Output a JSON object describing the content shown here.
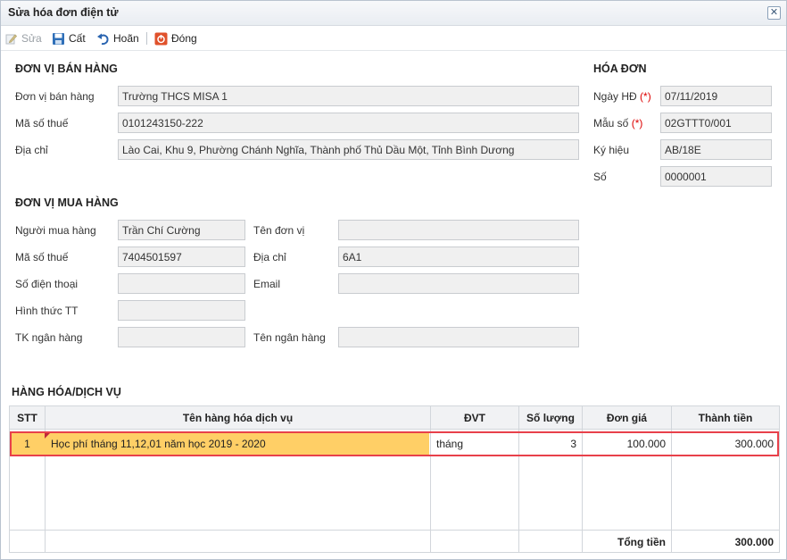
{
  "window": {
    "title": "Sửa hóa đơn điện tử",
    "close": "✕"
  },
  "toolbar": {
    "edit_label": "Sửa",
    "save_label": "Cất",
    "undo_label": "Hoãn",
    "close_label": "Đóng"
  },
  "seller": {
    "section_title": "ĐƠN VỊ BÁN HÀNG",
    "unit_label": "Đơn vị bán hàng",
    "unit_value": "Trường THCS MISA 1",
    "tax_label": "Mã số thuế",
    "tax_value": "0101243150-222",
    "address_label": "Địa chỉ",
    "address_value": "Lào Cai, Khu 9, Phường Chánh Nghĩa, Thành phố Thủ Dầu Một, Tỉnh Bình Dương"
  },
  "invoice": {
    "section_title": "HÓA ĐƠN",
    "date_label": "Ngày HĐ",
    "required_mark": "(*)",
    "date_value": "07/11/2019",
    "template_label": "Mẫu số",
    "template_value": "02GTTT0/001",
    "symbol_label": "Ký hiệu",
    "symbol_value": "AB/18E",
    "number_label": "Số",
    "number_value": "0000001"
  },
  "buyer": {
    "section_title": "ĐƠN VỊ MUA HÀNG",
    "buyer_label": "Người mua hàng",
    "buyer_value": "Trần Chí Cường",
    "unit_name_label": "Tên đơn vị",
    "unit_name_value": "",
    "tax_label": "Mã số thuế",
    "tax_value": "7404501597",
    "address_label": "Địa chỉ",
    "address_value": "6A1",
    "phone_label": "Số điện thoại",
    "phone_value": "",
    "email_label": "Email",
    "email_value": "",
    "payment_label": "Hình thức TT",
    "payment_value": "",
    "bank_account_label": "TK ngân hàng",
    "bank_account_value": "",
    "bank_name_label": "Tên ngân hàng",
    "bank_name_value": ""
  },
  "goods": {
    "section_title": "HÀNG HÓA/DỊCH VỤ",
    "columns": {
      "stt": "STT",
      "name": "Tên hàng hóa dịch vụ",
      "unit": "ĐVT",
      "qty": "Số lượng",
      "price": "Đơn giá",
      "amount": "Thành tiền"
    },
    "rows": [
      {
        "stt": "1",
        "name": "Học phí tháng 11,12,01 năm học 2019 - 2020",
        "unit": "tháng",
        "qty": "3",
        "price": "100.000",
        "amount": "300.000"
      }
    ],
    "total_label": "Tổng tiền",
    "total_value": "300.000"
  },
  "colors": {
    "highlight": "#ffcf66",
    "selection_border": "#e8404a",
    "required": "#dd0000"
  }
}
